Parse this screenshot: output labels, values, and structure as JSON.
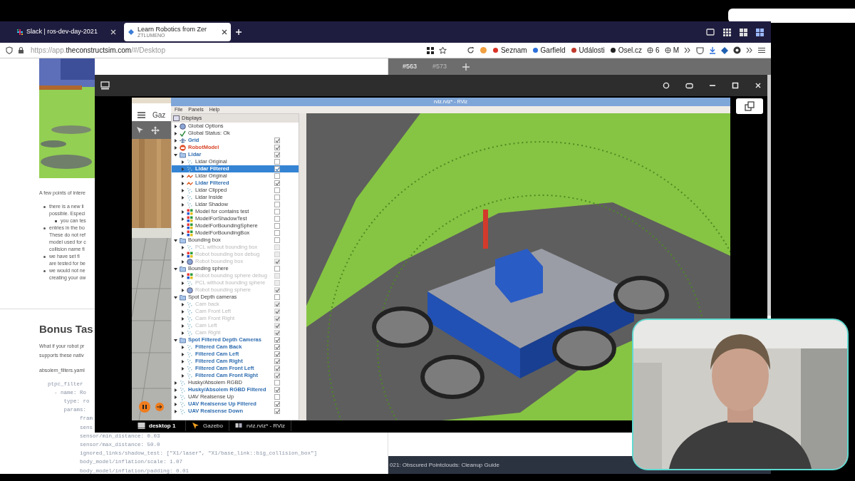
{
  "browser": {
    "tabs": [
      {
        "title": "Slack | ros-dev-day-2021",
        "selected": false
      },
      {
        "title": "Learn Robotics from Zer",
        "subtitle": "ZTLUMENO",
        "selected": true
      }
    ],
    "url_parts": [
      "https://app.",
      "theconstructsim.com",
      "/#/Desktop"
    ],
    "bookmarks": [
      "Seznam",
      "Garfield",
      "Události",
      "Osel.cz",
      "6",
      "M"
    ]
  },
  "doc": {
    "intro": "A few points of intere",
    "bullets": [
      {
        "lines": [
          "there is a new li",
          "possible. Especi"
        ],
        "children": [
          {
            "lines": [
              "you can tes"
            ]
          }
        ]
      },
      {
        "lines": [
          "entries in the  bo",
          "These do not ref",
          "model used for c",
          "collision name fi"
        ]
      },
      {
        "lines": [
          "we have set  fi",
          "are tested for be"
        ]
      },
      {
        "lines": [
          "we would not ne",
          "creating your ow"
        ]
      }
    ],
    "heading": "Bonus Tas",
    "paragraph": [
      "What if your robot pr",
      "supports these nativ"
    ],
    "filename": "absolem_filters.yaml",
    "code": [
      "ptpc_filter",
      "  - name: Ro",
      "     type: ro",
      "     params:",
      "          fram",
      "          sens",
      "          sensor/min_distance: 0.03",
      "          sensor/max_distance: 50.0",
      "          ignored_links/shadow_test: [\"X1/laser\", \"X1/base_link::big_collision_box\"]",
      "          body_model/inflation/scale: 1.07",
      "          body_model/inflation/padding: 0.01"
    ]
  },
  "side": {
    "tabs": [
      {
        "label": "#563",
        "selected": true
      },
      {
        "label": "#573",
        "selected": false
      }
    ],
    "footer": "021: Obscured Pointclouds: Cleanup Guide"
  },
  "gazebo": {
    "title": "Gaz"
  },
  "rviz": {
    "title": "rviz.rviz* - RViz",
    "menu": [
      "File",
      "Panels",
      "Help"
    ],
    "panel_title": "Displays",
    "displays": [
      {
        "label": "Global Options",
        "kind": "globe",
        "expanded": false,
        "selected": false,
        "bold": false,
        "disabled": false,
        "error": false
      },
      {
        "label": "Global Status: Ok",
        "kind": "status",
        "expanded": false,
        "selected": false,
        "bold": false,
        "disabled": false,
        "error": false
      },
      {
        "label": "Grid",
        "kind": "grid",
        "expanded": false,
        "checked": true,
        "selected": false,
        "bold": true,
        "disabled": false,
        "error": false
      },
      {
        "label": "RobotModel",
        "kind": "robot",
        "expanded": false,
        "checked": true,
        "selected": false,
        "bold": true,
        "disabled": false,
        "error": true
      },
      {
        "label": "Lidar",
        "kind": "folder",
        "expanded": true,
        "checked": true,
        "selected": false,
        "bold": true,
        "disabled": false,
        "error": false,
        "children": [
          {
            "label": "Lidar Original",
            "kind": "cloud",
            "expanded": false,
            "checked": false,
            "selected": false,
            "bold": false,
            "disabled": false,
            "error": false
          },
          {
            "label": "Lidar Filtered",
            "kind": "cloud",
            "expanded": false,
            "checked": true,
            "selected": true,
            "bold": true,
            "disabled": false,
            "error": false
          },
          {
            "label": "Lidar Original",
            "kind": "laser",
            "expanded": false,
            "checked": false,
            "selected": false,
            "bold": false,
            "disabled": false,
            "error": false
          },
          {
            "label": "Lidar Filtered",
            "kind": "laser",
            "expanded": false,
            "checked": true,
            "selected": false,
            "bold": true,
            "disabled": false,
            "error": false
          },
          {
            "label": "Lidar Clipped",
            "kind": "cloud",
            "expanded": false,
            "checked": false,
            "selected": false,
            "bold": false,
            "disabled": false,
            "error": false
          },
          {
            "label": "Lidar Inside",
            "kind": "cloud",
            "expanded": false,
            "checked": false,
            "selected": false,
            "bold": false,
            "disabled": false,
            "error": false
          },
          {
            "label": "Lidar Shadow",
            "kind": "cloud",
            "expanded": false,
            "checked": false,
            "selected": false,
            "bold": false,
            "disabled": false,
            "error": false
          },
          {
            "label": "Model for contains test",
            "kind": "marker",
            "expanded": false,
            "checked": false,
            "selected": false,
            "bold": false,
            "disabled": false,
            "error": false
          },
          {
            "label": "ModelForShadowTest",
            "kind": "marker",
            "expanded": false,
            "checked": false,
            "selected": false,
            "bold": false,
            "disabled": false,
            "error": false
          },
          {
            "label": "ModelForBoundingSphere",
            "kind": "marker",
            "expanded": false,
            "checked": false,
            "selected": false,
            "bold": false,
            "disabled": false,
            "error": false
          },
          {
            "label": "ModelForBoundingBox",
            "kind": "marker",
            "expanded": false,
            "checked": false,
            "selected": false,
            "bold": false,
            "disabled": false,
            "error": false
          }
        ]
      },
      {
        "label": "Bounding box",
        "kind": "folder",
        "expanded": true,
        "checked": false,
        "selected": false,
        "bold": false,
        "disabled": false,
        "error": false,
        "children": [
          {
            "label": "PCL without bounding box",
            "kind": "cloud",
            "expanded": false,
            "checked": false,
            "selected": false,
            "bold": false,
            "disabled": true,
            "error": false
          },
          {
            "label": "Robot bounding box debug",
            "kind": "marker",
            "expanded": false,
            "checked": false,
            "selected": false,
            "bold": false,
            "disabled": true,
            "error": false
          },
          {
            "label": "Robot bounding box",
            "kind": "globe",
            "expanded": false,
            "checked": true,
            "selected": false,
            "bold": false,
            "disabled": true,
            "error": false
          }
        ]
      },
      {
        "label": "Bounding sphere",
        "kind": "folder",
        "expanded": true,
        "checked": false,
        "selected": false,
        "bold": false,
        "disabled": false,
        "error": false,
        "children": [
          {
            "label": "Robot bounding sphere debug",
            "kind": "marker",
            "expanded": false,
            "checked": false,
            "selected": false,
            "bold": false,
            "disabled": true,
            "error": false
          },
          {
            "label": "PCL without bounding sphere",
            "kind": "cloud",
            "expanded": false,
            "checked": false,
            "selected": false,
            "bold": false,
            "disabled": true,
            "error": false
          },
          {
            "label": "Robot bounding sphere",
            "kind": "globe",
            "expanded": false,
            "checked": true,
            "selected": false,
            "bold": false,
            "disabled": true,
            "error": false
          }
        ]
      },
      {
        "label": "Spot Depth cameras",
        "kind": "folder",
        "expanded": true,
        "checked": false,
        "selected": false,
        "bold": false,
        "disabled": false,
        "error": false,
        "children": [
          {
            "label": "Cam back",
            "kind": "cloud",
            "expanded": false,
            "checked": true,
            "selected": false,
            "bold": false,
            "disabled": true,
            "error": false
          },
          {
            "label": "Cam Front Left",
            "kind": "cloud",
            "expanded": false,
            "checked": true,
            "selected": false,
            "bold": false,
            "disabled": true,
            "error": false
          },
          {
            "label": "Cam Front Right",
            "kind": "cloud",
            "expanded": false,
            "checked": true,
            "selected": false,
            "bold": false,
            "disabled": true,
            "error": false
          },
          {
            "label": "Cam Left",
            "kind": "cloud",
            "expanded": false,
            "checked": true,
            "selected": false,
            "bold": false,
            "disabled": true,
            "error": false
          },
          {
            "label": "Cam Right",
            "kind": "cloud",
            "expanded": false,
            "checked": true,
            "selected": false,
            "bold": false,
            "disabled": true,
            "error": false
          }
        ]
      },
      {
        "label": "Spot Filtered Depth Cameras",
        "kind": "folder",
        "expanded": true,
        "checked": true,
        "selected": false,
        "bold": true,
        "disabled": false,
        "error": false,
        "children": [
          {
            "label": "Filtered Cam Back",
            "kind": "cloud",
            "expanded": false,
            "checked": true,
            "selected": false,
            "bold": true,
            "disabled": false,
            "error": false
          },
          {
            "label": "Filtered Cam Left",
            "kind": "cloud",
            "expanded": false,
            "checked": true,
            "selected": false,
            "bold": true,
            "disabled": false,
            "error": false
          },
          {
            "label": "Filtered Cam Right",
            "kind": "cloud",
            "expanded": false,
            "checked": true,
            "selected": false,
            "bold": true,
            "disabled": false,
            "error": false
          },
          {
            "label": "Filtered Cam Front Left",
            "kind": "cloud",
            "expanded": false,
            "checked": true,
            "selected": false,
            "bold": true,
            "disabled": false,
            "error": false
          },
          {
            "label": "Filtered Cam Front Right",
            "kind": "cloud",
            "expanded": false,
            "checked": true,
            "selected": false,
            "bold": true,
            "disabled": false,
            "error": false
          }
        ]
      },
      {
        "label": "Husky/Absolem RGBD",
        "kind": "cloud",
        "expanded": false,
        "checked": false,
        "selected": false,
        "bold": false,
        "disabled": false,
        "error": false
      },
      {
        "label": "Husky/Absolem RGBD Filtered",
        "kind": "cloud",
        "expanded": false,
        "checked": true,
        "selected": false,
        "bold": true,
        "disabled": false,
        "error": false
      },
      {
        "label": "UAV Realsense Up",
        "kind": "cloud",
        "expanded": false,
        "checked": false,
        "selected": false,
        "bold": false,
        "disabled": false,
        "error": false
      },
      {
        "label": "UAV Realsense Up Filtered",
        "kind": "cloud",
        "expanded": false,
        "checked": true,
        "selected": false,
        "bold": true,
        "disabled": false,
        "error": false
      },
      {
        "label": "UAV Realsense Down",
        "kind": "cloud",
        "expanded": false,
        "checked": true,
        "selected": false,
        "bold": true,
        "disabled": false,
        "error": false
      }
    ]
  },
  "taskbar": [
    {
      "label": "desktop 1",
      "kind": "desktop"
    },
    {
      "label": "Gazebo",
      "kind": "gazebo"
    },
    {
      "label": "rviz.rviz* - RViz",
      "kind": "rviz"
    }
  ]
}
